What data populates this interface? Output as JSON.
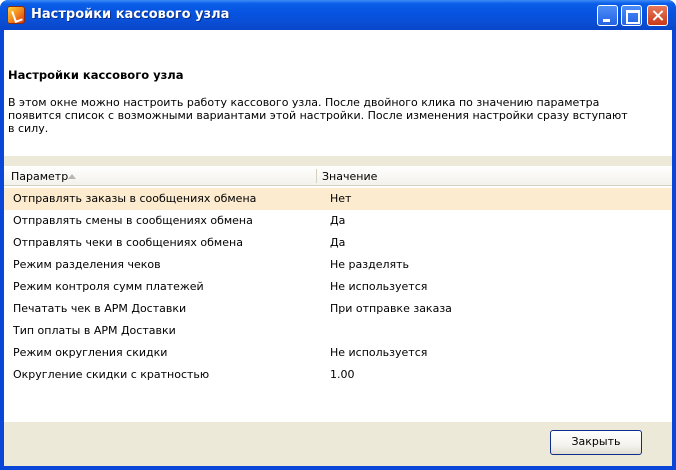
{
  "window": {
    "title": "Настройки кассового узла"
  },
  "header": {
    "title": "Настройки кассового узла",
    "description": "В этом окне можно настроить работу кассового узла. После двойного клика по значению параметра появится список с возможными вариантами этой настройки. После изменения настройки сразу вступают в силу."
  },
  "table": {
    "columns": [
      "Параметр",
      "Значение"
    ],
    "rows": [
      {
        "param": "Отправлять заказы в сообщениях обмена",
        "value": "Нет"
      },
      {
        "param": "Отправлять смены в сообщениях обмена",
        "value": "Да"
      },
      {
        "param": "Отправлять чеки в сообщениях обмена",
        "value": "Да"
      },
      {
        "param": "Режим разделения чеков",
        "value": "Не разделять"
      },
      {
        "param": "Режим контроля сумм платежей",
        "value": "Не используется"
      },
      {
        "param": "Печатать чек в АРМ Доставки",
        "value": "При отправке заказа"
      },
      {
        "param": "Тип оплаты в АРМ Доставки",
        "value": ""
      },
      {
        "param": "Режим округления скидки",
        "value": "Не используется"
      },
      {
        "param": "Округление скидки с кратностью",
        "value": "1.00"
      }
    ],
    "selected_row": 0
  },
  "footer": {
    "close_label": "Закрыть"
  }
}
